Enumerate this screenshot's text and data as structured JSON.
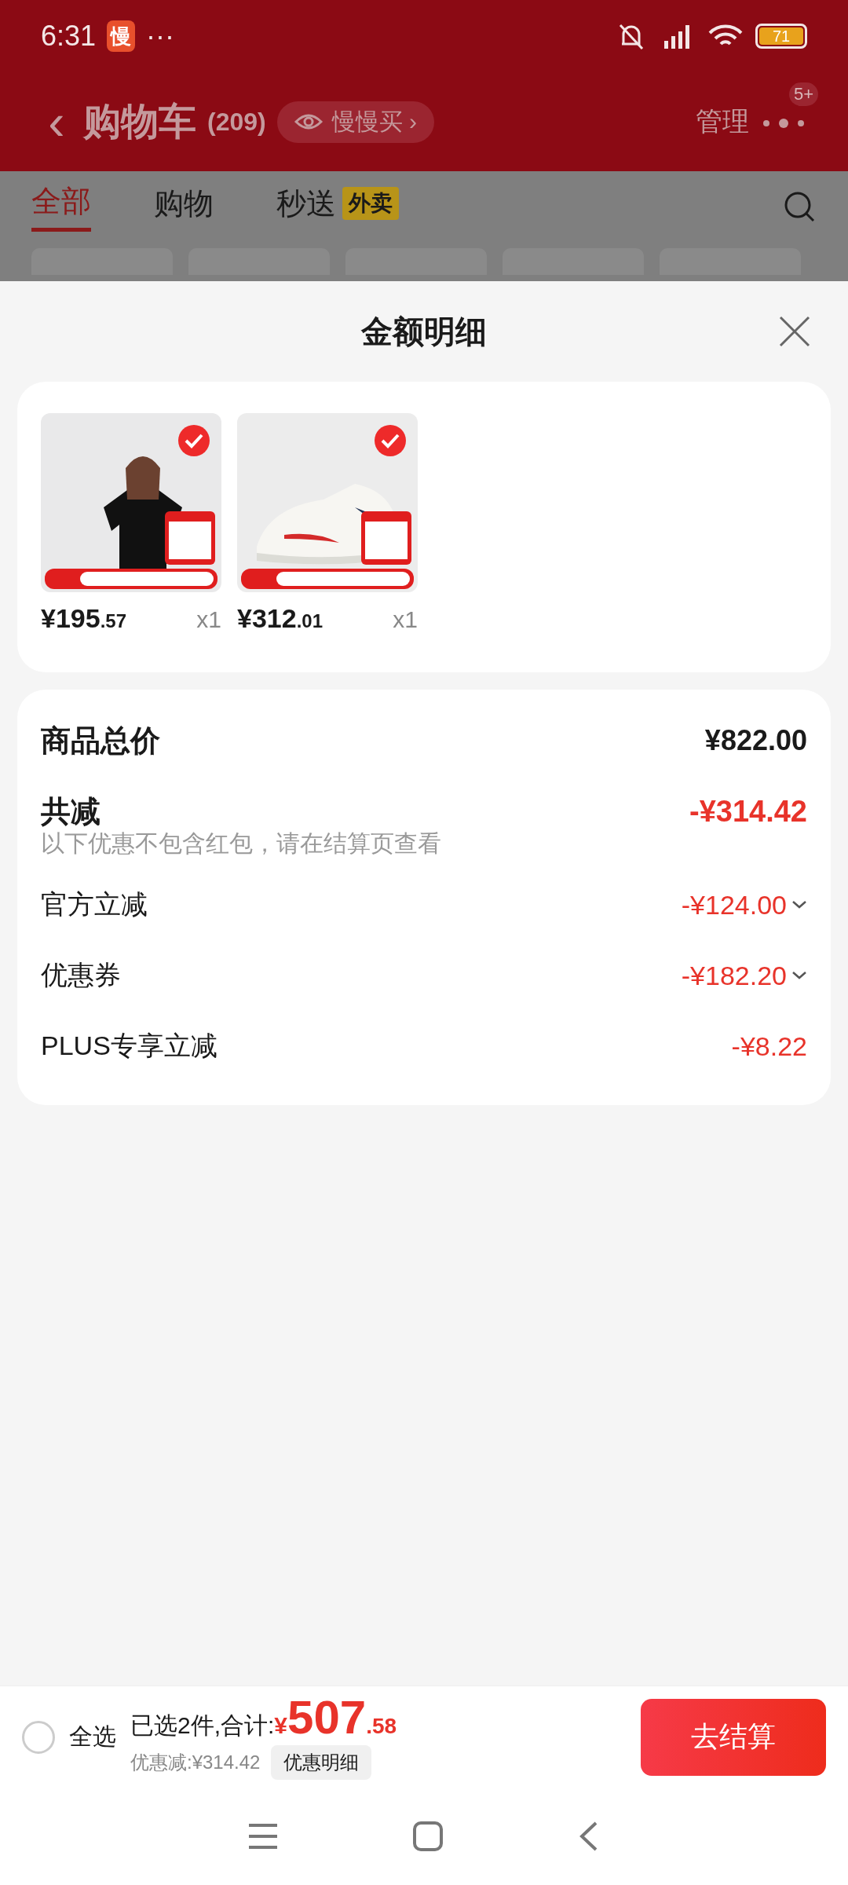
{
  "status_bar": {
    "time": "6:31",
    "app_badge": "慢",
    "more": "···",
    "battery": "71"
  },
  "header": {
    "back": "‹",
    "title": "购物车",
    "count": "(209)",
    "slow_buy": "慢慢买",
    "slow_buy_arrow": "›",
    "manage": "管理",
    "badge": "5+"
  },
  "tabs": [
    {
      "label": "全部",
      "selected": true
    },
    {
      "label": "购物",
      "selected": false
    },
    {
      "label": "秒送",
      "selected": false,
      "tag": "外卖"
    }
  ],
  "sheet": {
    "title": "金额明细",
    "items": [
      {
        "kind": "shirt",
        "checked": true,
        "price": "¥195",
        "cents": ".57",
        "qty": "x1"
      },
      {
        "kind": "shoe",
        "checked": true,
        "price": "¥312",
        "cents": ".01",
        "qty": "x1"
      }
    ],
    "total": {
      "label": "商品总价",
      "value": "¥822.00"
    },
    "reduction": {
      "label": "共减",
      "value": "-¥314.42",
      "note": "以下优惠不包含红包，请在结算页查看"
    },
    "lines": [
      {
        "label": "官方立减",
        "value": "-¥124.00",
        "expandable": true
      },
      {
        "label": "优惠券",
        "value": "-¥182.20",
        "expandable": true
      },
      {
        "label": "PLUS专享立减",
        "value": "-¥8.22",
        "expandable": false
      }
    ]
  },
  "bottom_bar": {
    "select_all": {
      "label": "全选",
      "checked": false
    },
    "summary": "已选2件,合计:",
    "currency": "¥",
    "amount": "507",
    "cents": ".58",
    "discount": "优惠减:¥314.42",
    "detail_button": "优惠明细",
    "checkout": "去结算"
  }
}
